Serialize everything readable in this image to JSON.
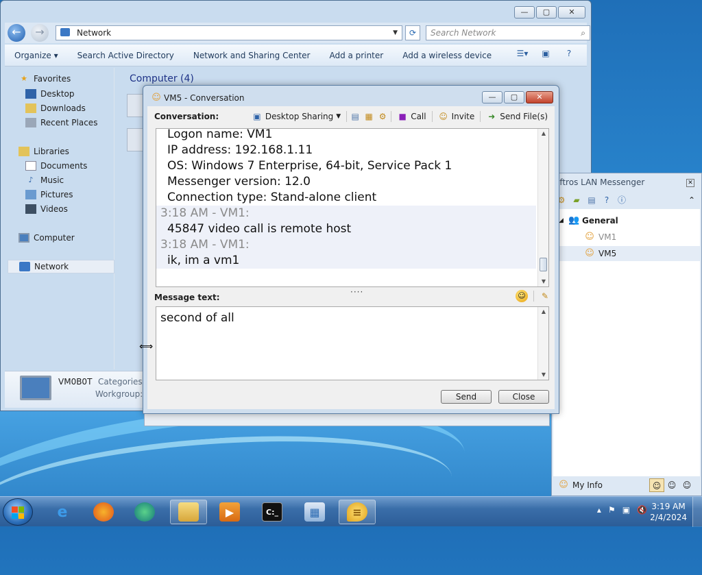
{
  "explorer": {
    "address": "Network",
    "search_placeholder": "Search Network",
    "commands": [
      "Organize ▾",
      "Search Active Directory",
      "Network and Sharing Center",
      "Add a printer",
      "Add a wireless device"
    ],
    "nav": {
      "favorites": "Favorites",
      "desktop": "Desktop",
      "downloads": "Downloads",
      "recent": "Recent Places",
      "libraries": "Libraries",
      "documents": "Documents",
      "music": "Music",
      "pictures": "Pictures",
      "videos": "Videos",
      "computer": "Computer",
      "network": "Network"
    },
    "group_title": "Computer (4)",
    "details": {
      "name": "VM0B0T",
      "categories_label": "Categories:",
      "workgroup_label": "Workgroup:"
    }
  },
  "messenger": {
    "title": "oftros LAN Messenger",
    "group": "General",
    "contacts": [
      "VM1",
      "VM5"
    ],
    "my_info": "My Info"
  },
  "conversation": {
    "title": "VM5 - Conversation",
    "label": "Conversation:",
    "toolbar": {
      "desktop_sharing": "Desktop Sharing",
      "call": "Call",
      "invite": "Invite",
      "send_files": "Send File(s)"
    },
    "lines": [
      {
        "text": "Logon name: VM1",
        "type": "body",
        "shaded": false
      },
      {
        "text": "IP address: 192.168.1.11",
        "type": "body",
        "shaded": false
      },
      {
        "text": "OS: Windows 7 Enterprise, 64-bit, Service Pack 1",
        "type": "body",
        "shaded": false
      },
      {
        "text": "Messenger version: 12.0",
        "type": "body",
        "shaded": false
      },
      {
        "text": "Connection type: Stand-alone client",
        "type": "body",
        "shaded": false
      },
      {
        "text": "3:18 AM - VM1:",
        "type": "head",
        "shaded": true
      },
      {
        "text": "45847 video call is remote host",
        "type": "body",
        "shaded": true
      },
      {
        "text": "3:18 AM - VM1:",
        "type": "head",
        "shaded": true
      },
      {
        "text": "ik, im a vm1",
        "type": "body",
        "shaded": true
      }
    ],
    "message_label": "Message text:",
    "message_value": "second of all",
    "send_label": "Send",
    "close_label": "Close"
  },
  "taskbar": {
    "time": "3:19 AM",
    "date": "2/4/2024"
  },
  "colors": {
    "accent": "#1e3287",
    "window_frame": "#cfdeee",
    "close_red": "#c2432c"
  }
}
